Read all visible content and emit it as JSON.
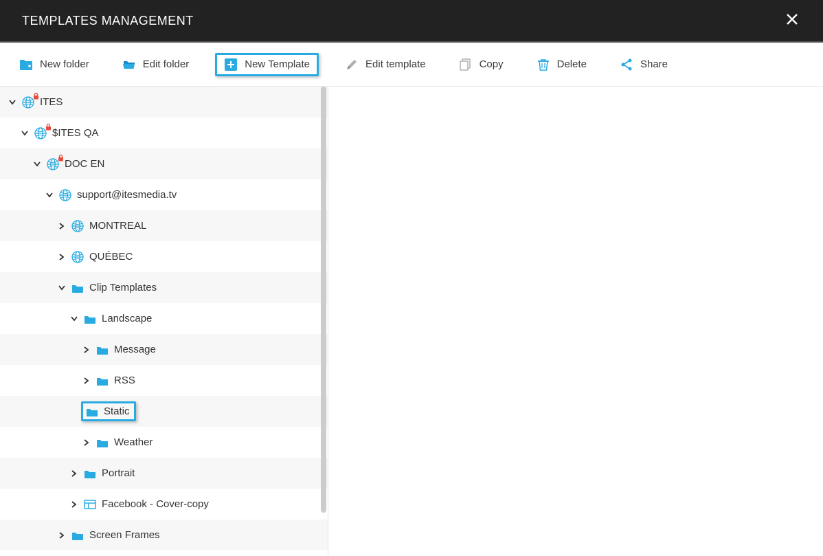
{
  "header": {
    "title": "TEMPLATES MANAGEMENT"
  },
  "toolbar": {
    "new_folder": "New folder",
    "edit_folder": "Edit folder",
    "new_template": "New Template",
    "edit_template": "Edit template",
    "copy": "Copy",
    "delete": "Delete",
    "share": "Share"
  },
  "tree": {
    "ites": "ITES",
    "sites_qa": "$ITES QA",
    "doc_en": "DOC EN",
    "support": "support@itesmedia.tv",
    "montreal": "MONTREAL",
    "quebec": "QUÉBEC",
    "clip_templates": "Clip Templates",
    "landscape": "Landscape",
    "message": "Message",
    "rss": "RSS",
    "static": "Static",
    "weather": "Weather",
    "portrait": "Portrait",
    "facebook": "Facebook - Cover-copy",
    "screen_frames": "Screen Frames"
  }
}
